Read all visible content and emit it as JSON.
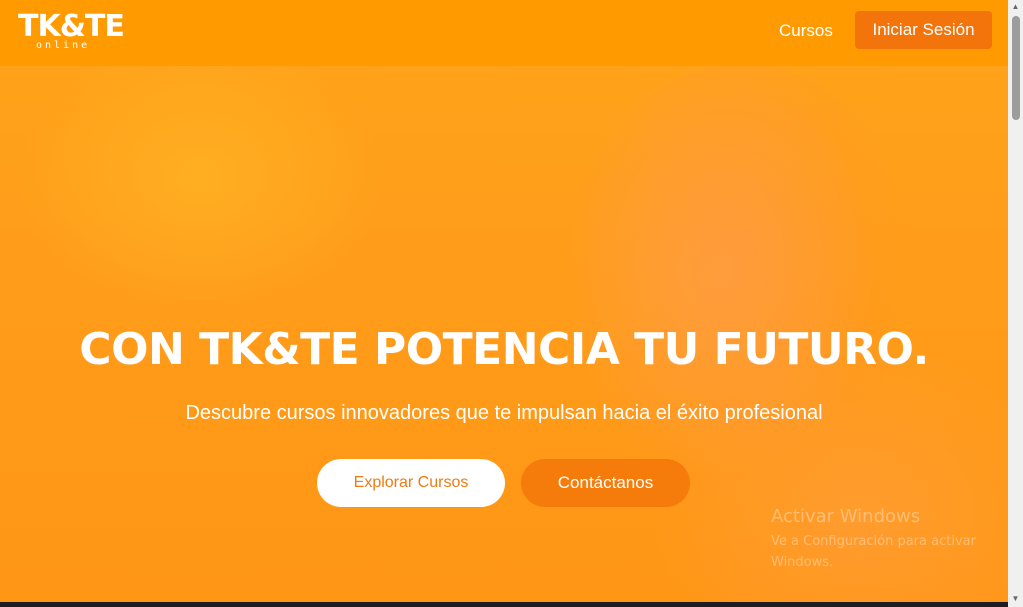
{
  "navbar": {
    "logo_main": "TK&TE",
    "logo_sub": "online",
    "links": [
      {
        "label": "Cursos"
      }
    ],
    "login_label": "Iniciar Sesión"
  },
  "hero": {
    "headline": "CON TK&TE POTENCIA TU FUTURO.",
    "subheadline": "Descubre cursos innovadores que te impulsan hacia el éxito profesional",
    "primary_button": "Explorar Cursos",
    "secondary_button": "Contáctanos"
  },
  "watermark": {
    "title": "Activar Windows",
    "subtitle": "Ve a Configuración para activar Windows."
  },
  "colors": {
    "brand_orange": "#ff9a00",
    "button_orange": "#f2740a",
    "white": "#ffffff"
  },
  "icons": {
    "scroll_up": "triangle-up-icon",
    "scroll_down": "triangle-down-icon"
  }
}
